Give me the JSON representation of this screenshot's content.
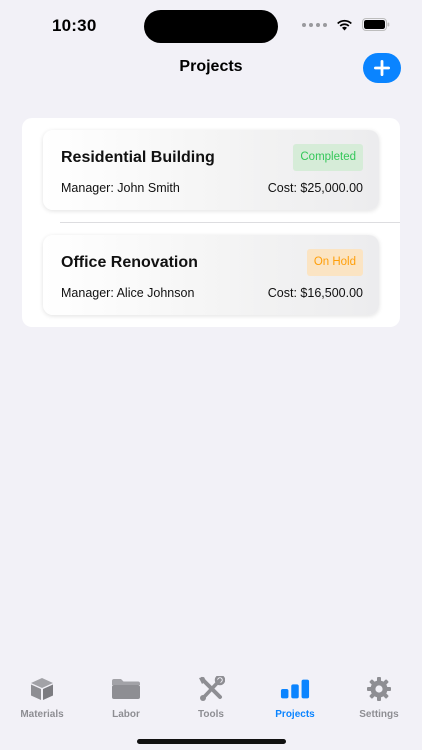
{
  "status_bar": {
    "time": "10:30"
  },
  "nav": {
    "title": "Projects",
    "add_icon": "plus-icon"
  },
  "projects": [
    {
      "name": "Residential Building",
      "status": "Completed",
      "manager": "Manager: John Smith",
      "cost": "Cost: $25,000.00",
      "status_color": "#34c759"
    },
    {
      "name": "Office Renovation",
      "status": "On Hold",
      "manager": "Manager: Alice Johnson",
      "cost": "Cost: $16,500.00",
      "status_color": "#ff9f0a"
    }
  ],
  "tabs": [
    {
      "label": "Materials",
      "icon": "box-icon",
      "active": false
    },
    {
      "label": "Labor",
      "icon": "folder-icon",
      "active": false
    },
    {
      "label": "Tools",
      "icon": "tools-icon",
      "active": false
    },
    {
      "label": "Projects",
      "icon": "bar-chart-icon",
      "active": true
    },
    {
      "label": "Settings",
      "icon": "gear-icon",
      "active": false
    }
  ],
  "colors": {
    "accent": "#0a84ff",
    "background": "#f2f1f7",
    "inactive": "#8e8e93"
  }
}
